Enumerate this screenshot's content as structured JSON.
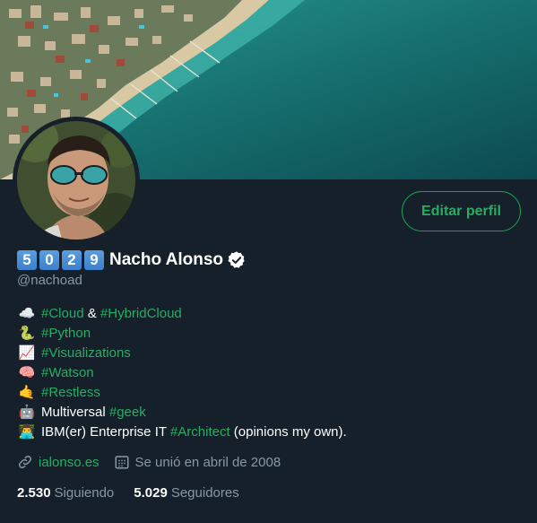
{
  "profile": {
    "name_digits": [
      "5",
      "0",
      "2",
      "9"
    ],
    "display_name": "Nacho Alonso",
    "handle": "@nachoad",
    "edit_label": "Editar perfil",
    "verified": true
  },
  "bio": [
    {
      "emoji": "☁️",
      "emoji_name": "cloud-icon",
      "parts": [
        {
          "text": "#Cloud",
          "tag": true
        },
        {
          "text": " & ",
          "tag": false
        },
        {
          "text": "#HybridCloud",
          "tag": true
        }
      ]
    },
    {
      "emoji": "🐍",
      "emoji_name": "snake-icon",
      "parts": [
        {
          "text": "#Python",
          "tag": true
        }
      ]
    },
    {
      "emoji": "📈",
      "emoji_name": "chart-increasing-icon",
      "parts": [
        {
          "text": "#Visualizations",
          "tag": true
        }
      ]
    },
    {
      "emoji": "🧠",
      "emoji_name": "brain-icon",
      "parts": [
        {
          "text": "#Watson",
          "tag": true
        }
      ]
    },
    {
      "emoji": "🤙",
      "emoji_name": "call-me-hand-icon",
      "parts": [
        {
          "text": "#Restless",
          "tag": true
        }
      ]
    },
    {
      "emoji": "🤖",
      "emoji_name": "robot-icon",
      "parts": [
        {
          "text": "Multiversal ",
          "tag": false
        },
        {
          "text": "#geek",
          "tag": true
        }
      ]
    },
    {
      "emoji": "👨‍💻",
      "emoji_name": "technologist-icon",
      "parts": [
        {
          "text": "IBM(er) Enterprise IT ",
          "tag": false
        },
        {
          "text": "#Architect",
          "tag": true
        },
        {
          "text": " (opinions my own).",
          "tag": false
        }
      ]
    }
  ],
  "meta": {
    "website": "ialonso.es",
    "joined": "Se unió en abril de 2008"
  },
  "stats": {
    "following_count": "2.530",
    "following_label": "Siguiendo",
    "followers_count": "5.029",
    "followers_label": "Seguidores"
  },
  "colors": {
    "background": "#15202b",
    "accent": "#27ae60",
    "secondary_text": "#8899a6"
  }
}
